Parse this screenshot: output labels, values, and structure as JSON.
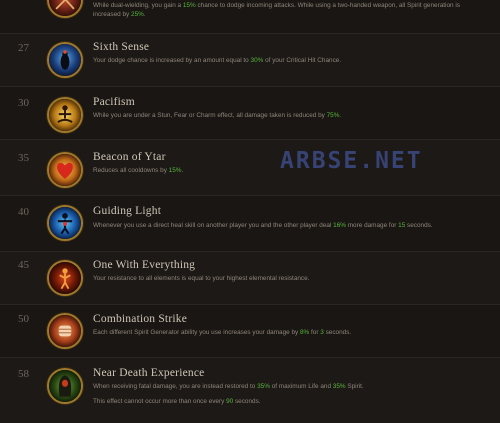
{
  "watermark": "ARBSE.NET",
  "colors": {
    "highlight": "#58b73a",
    "background": "#151311",
    "icon_border": "#a07a2c"
  },
  "top_partial": {
    "icon": "crossed-blades-icon",
    "text_a": "While dual-wielding, you gain a ",
    "value_a": "15%",
    "text_b": " chance to dodge incoming attacks. While using a two-handed weapon, all Spirit generation is",
    "text_c": "increased by ",
    "value_c": "25%",
    "text_d": "."
  },
  "passives": [
    {
      "level": "27",
      "name": "Sixth Sense",
      "icon": "eye-icon",
      "a": "Your dodge chance is increased by an amount equal to ",
      "v1": "30%",
      "b": " of your Critical Hit Chance.",
      "v2": "",
      "c": "",
      "v3": "",
      "d": ""
    },
    {
      "level": "30",
      "name": "Pacifism",
      "icon": "meditating-monk-icon",
      "a": "While you are under a Stun, Fear or Charm effect, all damage taken is reduced by ",
      "v1": "75%",
      "b": ".",
      "v2": "",
      "c": "",
      "v3": "",
      "d": ""
    },
    {
      "level": "35",
      "name": "Beacon of Ytar",
      "icon": "heart-icon",
      "a": "Reduces all cooldowns by ",
      "v1": "15%",
      "b": ".",
      "v2": "",
      "c": "",
      "v3": "",
      "d": ""
    },
    {
      "level": "40",
      "name": "Guiding Light",
      "icon": "glowing-figure-icon",
      "a": "Whenever you use a direct heal skill on another player you and the other player deal ",
      "v1": "16%",
      "b": " more damage for ",
      "v2": "15",
      "c": " seconds.",
      "v3": "",
      "d": ""
    },
    {
      "level": "45",
      "name": "One With Everything",
      "icon": "red-figure-icon",
      "a": "Your resistance to all elements is equal to your highest elemental resistance.",
      "v1": "",
      "b": "",
      "v2": "",
      "c": "",
      "v3": "",
      "d": ""
    },
    {
      "level": "50",
      "name": "Combination Strike",
      "icon": "fist-icon",
      "a": "Each different Spirit Generator ability you use increases your damage by ",
      "v1": "8%",
      "b": " for ",
      "v2": "3",
      "c": " seconds.",
      "v3": "",
      "d": ""
    },
    {
      "level": "58",
      "name": "Near Death Experience",
      "icon": "hooded-figure-icon",
      "a": "When receiving fatal damage, you are instead restored to ",
      "v1": "35%",
      "b": " of maximum Life and ",
      "v2": "35%",
      "c": " Spirit.",
      "v3": "",
      "d": ""
    }
  ],
  "near_death_extra": {
    "a": "This effect cannot occur more than once every ",
    "v": "90",
    "b": " seconds."
  }
}
